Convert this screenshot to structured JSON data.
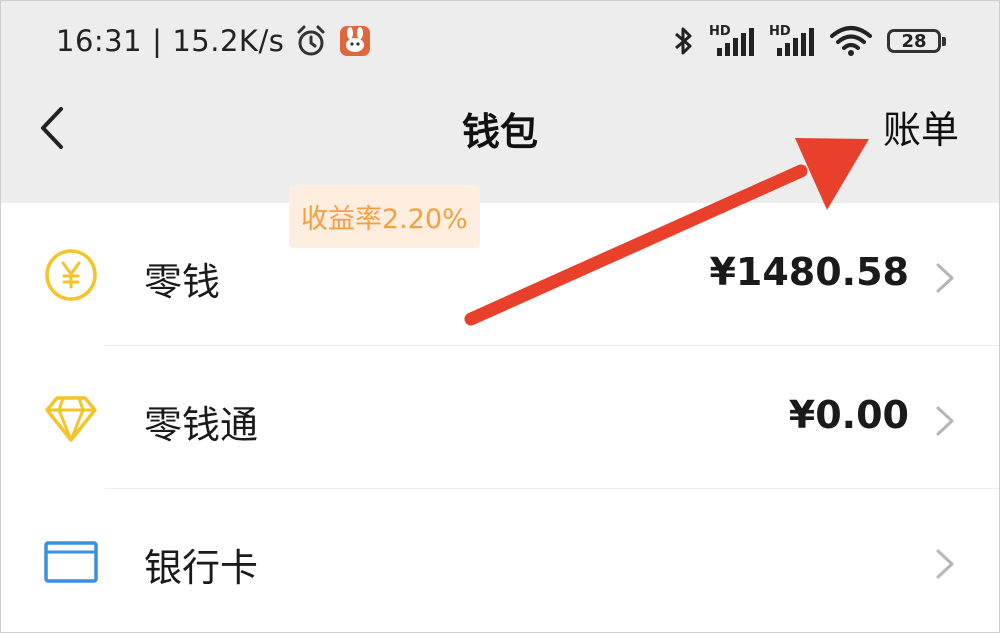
{
  "status_bar": {
    "time": "16:31",
    "separator": "|",
    "net_speed": "15.2K/s",
    "signal_1_label": "HD",
    "signal_2_label": "HD",
    "battery_level": "28",
    "icons": [
      "alarm-icon",
      "app-notification-icon",
      "bluetooth-icon",
      "signal-icon",
      "wifi-icon",
      "battery-icon"
    ]
  },
  "navbar": {
    "back_icon": "chevron-left-icon",
    "title": "钱包",
    "bill_label": "账单"
  },
  "wallet_items": [
    {
      "icon": "yuan-coin-icon",
      "label": "零钱",
      "amount": "¥1480.58"
    },
    {
      "icon": "diamond-icon",
      "label": "零钱通",
      "badge": "收益率2.20%",
      "amount": "¥0.00"
    },
    {
      "icon": "bank-card-icon",
      "label": "银行卡",
      "amount": ""
    }
  ],
  "colors": {
    "header_bg": "#ededed",
    "coin_yellow": "#f4c428",
    "card_blue": "#3e8ee0",
    "badge_bg": "#fdeee0",
    "badge_text": "#f2a040",
    "annotation_arrow": "#e8402a"
  }
}
